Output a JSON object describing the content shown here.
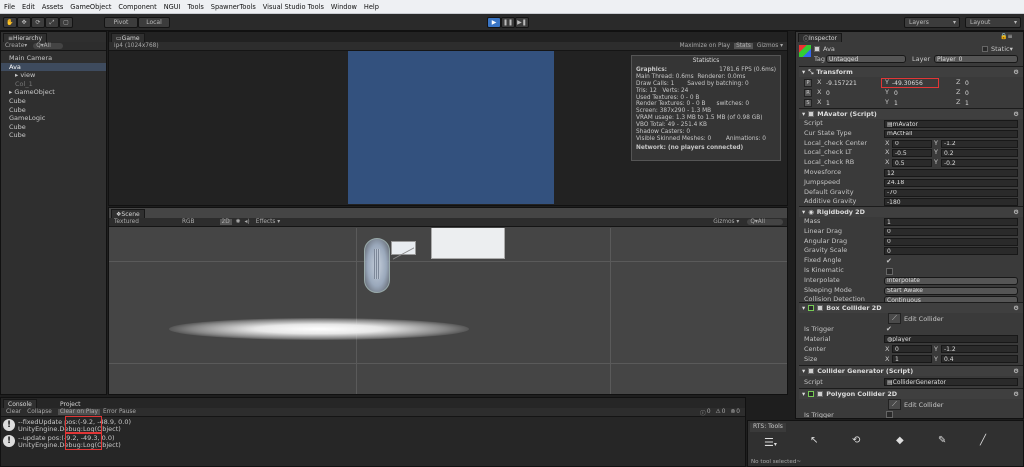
{
  "menu": [
    "File",
    "Edit",
    "Assets",
    "GameObject",
    "Component",
    "NGUI",
    "Tools",
    "SpawnerTools",
    "Visual Studio Tools",
    "Window",
    "Help"
  ],
  "toolbar": {
    "pivot": "Pivot",
    "local": "Local",
    "layers": "Layers",
    "layout": "Layout"
  },
  "hierarchy": {
    "tab": "Hierarchy",
    "create": "Create",
    "search": "Q▾All",
    "items": [
      {
        "label": "Main Camera",
        "indent": 0
      },
      {
        "label": "Ava",
        "indent": 0,
        "selected": true
      },
      {
        "label": "▸ view",
        "indent": 1
      },
      {
        "label": "Col_1",
        "indent": 1,
        "dim": true
      },
      {
        "label": "▸ GameObject",
        "indent": 0
      },
      {
        "label": "Cube",
        "indent": 0
      },
      {
        "label": "Cube",
        "indent": 0
      },
      {
        "label": "GameLogic",
        "indent": 0
      },
      {
        "label": "Cube",
        "indent": 0
      },
      {
        "label": "Cube",
        "indent": 0
      }
    ]
  },
  "game": {
    "tab": "Game",
    "aspect": "ip4 (1024x768)",
    "maximize": "Maximize on Play",
    "stats_btn": "Stats",
    "gizmos": "Gizmos ▾",
    "stats": {
      "title": "Statistics",
      "graphics_label": "Graphics:",
      "fps": "1781.6 FPS (0.6ms)",
      "lines": [
        "Main Thread: 0.6ms  Renderer: 0.0ms",
        "Draw Calls: 1       Saved by batching: 0",
        "Tris: 12   Verts: 24",
        "Used Textures: 0 - 0 B",
        "Render Textures: 0 - 0 B      switches: 0",
        "Screen: 387x290 - 1.3 MB",
        "VRAM usage: 1.3 MB to 1.5 MB (of 0.98 GB)",
        "VBO Total: 49 - 251.4 KB",
        "Shadow Casters: 0",
        "Visible Skinned Meshes: 0        Animations: 0"
      ],
      "network": "Network: (no players connected)"
    }
  },
  "scene": {
    "tab": "Scene",
    "shading": "Textured",
    "rgb": "RGB",
    "mode2d": "2D",
    "effects": "Effects ▾",
    "gizmos": "Gizmos ▾",
    "search": "Q▾All"
  },
  "console": {
    "tabs": [
      "Console",
      "Project"
    ],
    "buttons": [
      "Clear",
      "Collapse",
      "Clear on Play",
      "Error Pause"
    ],
    "counts": [
      "0",
      "0",
      "0"
    ],
    "entries": [
      {
        "line1": "--fixedUpdate pos:(-9.2, -48.9, 0.0)",
        "line2": "UnityEngine.Debug:Log(Object)"
      },
      {
        "line1": "--update pos:(-9.2, -49.3, 0.0)",
        "line2": "UnityEngine.Debug:Log(Object)"
      }
    ]
  },
  "rts": {
    "title": "RTS: Tools",
    "status": "No tool selected~"
  },
  "inspector": {
    "tab": "Inspector",
    "object_name": "Ava",
    "static": "Static",
    "tag_label": "Tag",
    "tag": "Untagged",
    "layer_label": "Layer",
    "layer": "Player_0",
    "transform": {
      "title": "Transform",
      "p": {
        "x": "-9.157221",
        "y": "-49.30656",
        "z": "0"
      },
      "r": {
        "x": "0",
        "y": "0",
        "z": "0"
      },
      "s": {
        "x": "1",
        "y": "1",
        "z": "1"
      }
    },
    "mavator": {
      "title": "MAvator (Script)",
      "rows": [
        {
          "label": "Script",
          "value": "mAvator"
        },
        {
          "label": "Cur State Type",
          "value": "mActFall"
        },
        {
          "label": "Local_check Center",
          "x": "0",
          "y": "-1.2"
        },
        {
          "label": "Local_check LT",
          "x": "-0.5",
          "y": "0.2"
        },
        {
          "label": "Local_check RB",
          "x": "0.5",
          "y": "-0.2"
        },
        {
          "label": "Movesforce",
          "value": "12"
        },
        {
          "label": "Jumpspeed",
          "value": "24.18"
        },
        {
          "label": "Default Gravity",
          "value": "-70"
        },
        {
          "label": "Additive Gravity",
          "value": "-180"
        }
      ]
    },
    "rigidbody": {
      "title": "Rigidbody 2D",
      "rows": [
        {
          "label": "Mass",
          "value": "1"
        },
        {
          "label": "Linear Drag",
          "value": "0"
        },
        {
          "label": "Angular Drag",
          "value": "0"
        },
        {
          "label": "Gravity Scale",
          "value": "0"
        },
        {
          "label": "Fixed Angle",
          "check": true
        },
        {
          "label": "Is Kinematic",
          "check": false
        },
        {
          "label": "Interpolate",
          "value": "Interpolate"
        },
        {
          "label": "Sleeping Mode",
          "value": "Start Awake"
        },
        {
          "label": "Collision Detection",
          "value": "Continuous"
        }
      ]
    },
    "box": {
      "title": "Box Collider 2D",
      "edit": "Edit Collider",
      "trigger_label": "Is Trigger",
      "material_label": "Material",
      "material": "player",
      "center_label": "Center",
      "cx": "0",
      "cy": "-1.2",
      "size_label": "Size",
      "sx": "1",
      "sy": "0.4"
    },
    "generator": {
      "title": "Collider Generator (Script)",
      "script_label": "Script",
      "script": "ColliderGenerator"
    },
    "polygon": {
      "title": "Polygon Collider 2D",
      "edit": "Edit Collider",
      "trigger_label": "Is Trigger"
    }
  }
}
